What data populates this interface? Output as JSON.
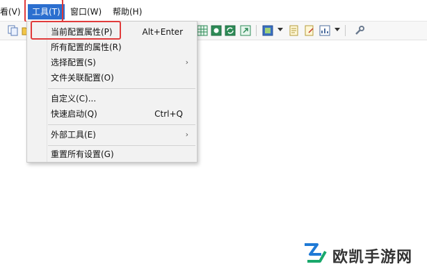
{
  "menubar": {
    "items": [
      {
        "label": "查看(V)"
      },
      {
        "label": "工具(T)"
      },
      {
        "label": "窗口(W)"
      },
      {
        "label": "帮助(H)"
      }
    ]
  },
  "dropdown": {
    "items": [
      {
        "label": "当前配置属性(P)",
        "shortcut": "Alt+Enter"
      },
      {
        "label": "所有配置的属性(R)",
        "shortcut": ""
      },
      {
        "label": "选择配置(S)",
        "submenu": true
      },
      {
        "label": "文件关联配置(O)",
        "shortcut": ""
      },
      {
        "label": "自定义(C)...",
        "shortcut": ""
      },
      {
        "label": "快速启动(Q)",
        "shortcut": "Ctrl+Q"
      },
      {
        "label": "外部工具(E)",
        "submenu": true
      },
      {
        "label": "重置所有设置(G)",
        "shortcut": ""
      }
    ],
    "submenu_arrow": "›"
  },
  "watermark": {
    "text": "欧凯手游网"
  },
  "colors": {
    "menu_active": "#2b6fcf",
    "highlight": "#e03a3a",
    "logo_blue": "#1f7ad6",
    "logo_green": "#19a86b"
  }
}
